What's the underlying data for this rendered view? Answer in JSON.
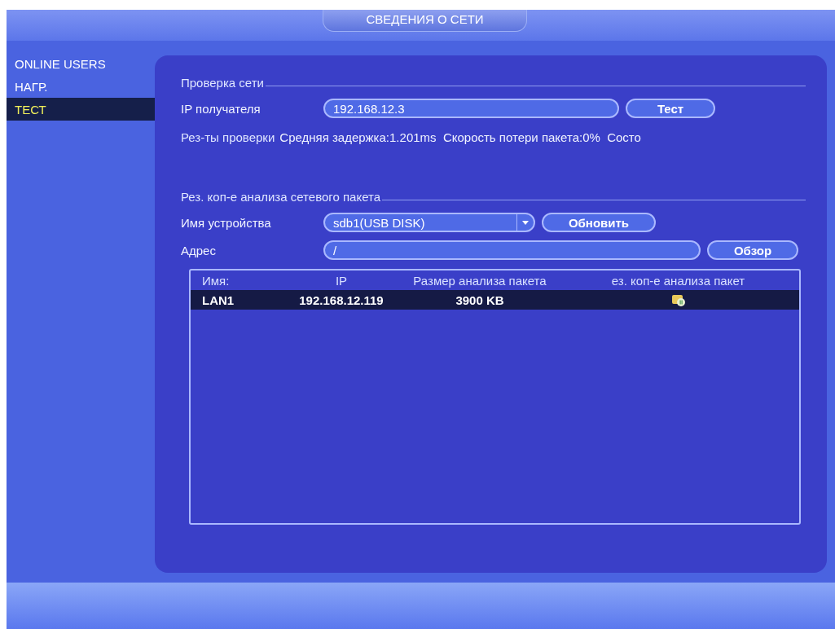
{
  "window": {
    "title": "СВЕДЕНИЯ О СЕТИ"
  },
  "sidebar": {
    "items": [
      {
        "label": "ONLINE USERS",
        "selected": false
      },
      {
        "label": "НАГР.",
        "selected": false
      },
      {
        "label": "ТЕСТ",
        "selected": true
      }
    ]
  },
  "network_test": {
    "heading": "Проверка сети",
    "ip_label": "IP получателя",
    "ip_value": "192.168.12.3",
    "test_button": "Тест",
    "results_label": "Рез-ты проверки",
    "results_value": "Средняя задержка:1.201ms  Скорость потери пакета:0%  Состо"
  },
  "packet_backup": {
    "heading": "Рез. коп-е анализа сетевого пакета",
    "device_label": "Имя устройства",
    "device_value": "sdb1(USB DISK)",
    "refresh_button": "Обновить",
    "address_label": "Адрес",
    "address_value": "/",
    "browse_button": "Обзор"
  },
  "table": {
    "columns": [
      "Имя:",
      "IP",
      "Размер анализа пакета",
      "ез. коп-е анализа пакет"
    ],
    "rows": [
      {
        "selected": true,
        "cells": [
          "LAN1",
          "192.168.12.119",
          "3900 KB"
        ],
        "paused": true
      }
    ]
  }
}
